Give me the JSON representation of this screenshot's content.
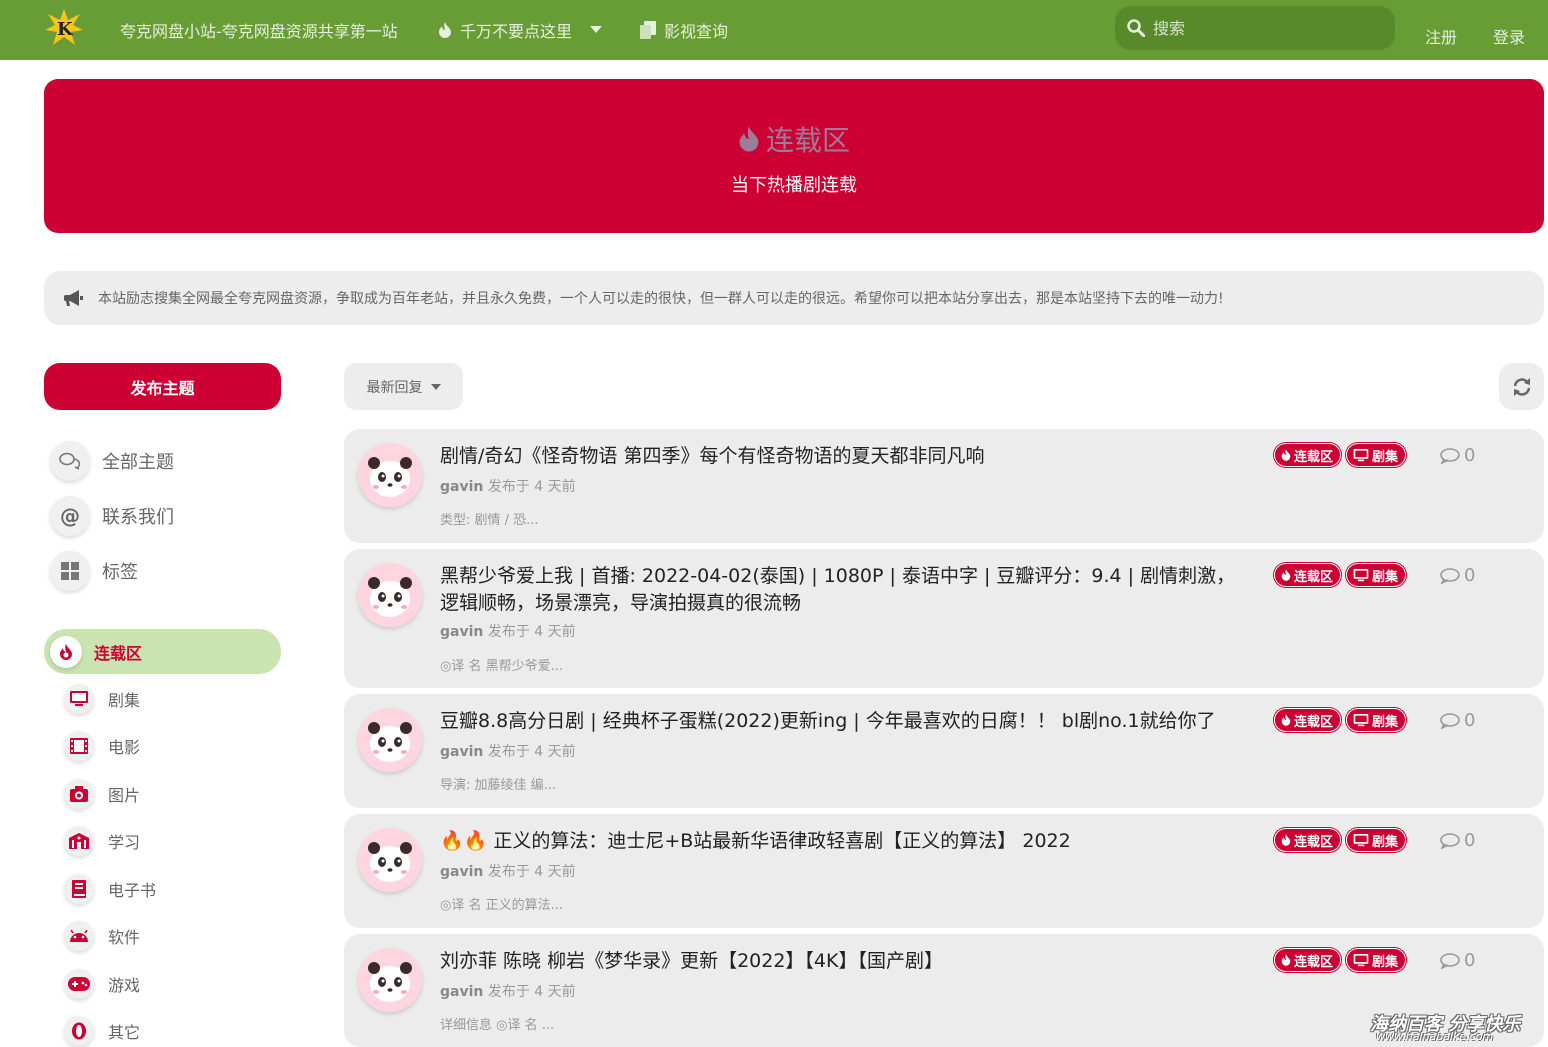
{
  "header": {
    "site_title": "夸克网盘小站-夸克网盘资源共享第一站",
    "nav_dont_click": "千万不要点这里",
    "nav_movie_query": "影视查询",
    "search_placeholder": "搜索",
    "register": "注册",
    "login": "登录",
    "brand_color": "#689c34"
  },
  "hero": {
    "title": "连载区",
    "subtitle": "当下热播剧连载",
    "color": "#cc0033"
  },
  "notice": {
    "text": "本站励志搜集全网最全夸克网盘资源，争取成为百年老站，并且永久免费，一个人可以走的很快，但一群人可以走的很远。希望你可以把本站分享出去，那是本站坚持下去的唯一动力!"
  },
  "sidebar": {
    "start_discussion": "发布主题",
    "links": [
      {
        "label": "全部主题",
        "icon": "comments-icon"
      },
      {
        "label": "联系我们",
        "icon": "at-icon"
      },
      {
        "label": "标签",
        "icon": "grid-icon"
      }
    ],
    "active_tag": "连载区",
    "tags": [
      {
        "label": "剧集",
        "icon": "tv-icon"
      },
      {
        "label": "电影",
        "icon": "film-icon"
      },
      {
        "label": "图片",
        "icon": "camera-icon"
      },
      {
        "label": "学习",
        "icon": "school-icon"
      },
      {
        "label": "电子书",
        "icon": "book-icon"
      },
      {
        "label": "软件",
        "icon": "android-icon"
      },
      {
        "label": "游戏",
        "icon": "gamepad-icon"
      },
      {
        "label": "其它",
        "icon": "opera-icon"
      }
    ]
  },
  "toolbar": {
    "sort_label": "最新回复"
  },
  "discussions": [
    {
      "title": "剧情/奇幻《怪奇物语 第四季》每个有怪奇物语的夏天都非同凡响",
      "author": "gavin",
      "meta": "发布于 4 天前",
      "excerpt": "类型: 剧情 / 恐...",
      "tag1": "连载区",
      "tag2": "剧集",
      "replies": "0"
    },
    {
      "title": "黑帮少爷爱上我 | 首播: 2022-04-02(泰国) | 1080P | 泰语中字 | 豆瓣评分：9.4 | 剧情刺激，逻辑顺畅，场景漂亮，导演拍摄真的很流畅",
      "author": "gavin",
      "meta": "发布于 4 天前",
      "excerpt": "◎译 名 黑帮少爷爱...",
      "tag1": "连载区",
      "tag2": "剧集",
      "replies": "0"
    },
    {
      "title": "豆瓣8.8高分日剧 | 经典杯子蛋糕(2022)更新ing | 今年最喜欢的日腐！！ bl剧no.1就给你了",
      "author": "gavin",
      "meta": "发布于 4 天前",
      "excerpt": "导演: 加藤绫佳 编...",
      "tag1": "连载区",
      "tag2": "剧集",
      "replies": "0"
    },
    {
      "title": "🔥🔥 正义的算法：迪士尼+B站最新华语律政轻喜剧【正义的算法】 2022",
      "author": "gavin",
      "meta": "发布于 4 天前",
      "excerpt": "◎译 名 正义的算法...",
      "tag1": "连载区",
      "tag2": "剧集",
      "replies": "0"
    },
    {
      "title": "刘亦菲 陈晓 柳岩《梦华录》更新【2022】【4K】【国产剧】",
      "author": "gavin",
      "meta": "发布于 4 天前",
      "excerpt": "详细信息 ◎译 名 ...",
      "tag1": "连载区",
      "tag2": "剧集",
      "replies": "0"
    }
  ],
  "watermark": {
    "text": "海纳百客 分享快乐",
    "url": "www.hainabaike.com"
  }
}
